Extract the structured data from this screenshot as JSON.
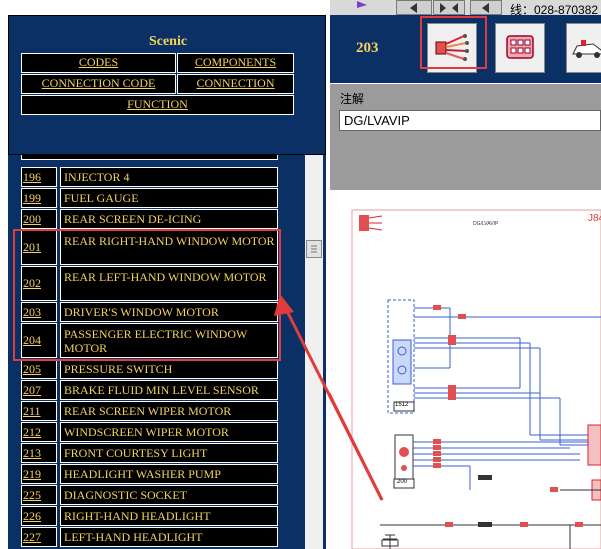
{
  "top": {
    "phone_text": "线：028-870382"
  },
  "header": {
    "vehicle": "Scenic",
    "buttons": {
      "codes": "CODES",
      "components": "COMPONENTS",
      "connection_code": "CONNECTION CODE",
      "connection": "CONNECTION",
      "function": "FUNCTION"
    },
    "part_number": "203",
    "icons": [
      "wiring-harness-icon",
      "connector-icon",
      "vehicle-icon"
    ],
    "highlight_color": "#e23b3b"
  },
  "diagram": {
    "label_chars": "注解",
    "name": "DG/LVAVIP",
    "title_small": "DG/LVAVIP",
    "corner_code": "J84",
    "labels": [
      "1512",
      "200"
    ]
  },
  "list": {
    "items": [
      {
        "num": "196",
        "label": "INJECTOR 4"
      },
      {
        "num": "199",
        "label": "FUEL GAUGE"
      },
      {
        "num": "200",
        "label": "REAR SCREEN DE-ICING"
      },
      {
        "num": "201",
        "label": "REAR RIGHT-HAND WINDOW MOTOR"
      },
      {
        "num": "202",
        "label": "REAR LEFT-HAND WINDOW MOTOR"
      },
      {
        "num": "203",
        "label": "DRIVER'S WINDOW MOTOR"
      },
      {
        "num": "204",
        "label": "PASSENGER ELECTRIC WINDOW MOTOR"
      },
      {
        "num": "205",
        "label": "PRESSURE SWITCH"
      },
      {
        "num": "207",
        "label": "BRAKE FLUID MIN LEVEL SENSOR"
      },
      {
        "num": "211",
        "label": "REAR SCREEN WIPER MOTOR"
      },
      {
        "num": "212",
        "label": "WINDSCREEN WIPER MOTOR"
      },
      {
        "num": "213",
        "label": "FRONT COURTESY LIGHT"
      },
      {
        "num": "219",
        "label": "HEADLIGHT WASHER PUMP"
      },
      {
        "num": "225",
        "label": "DIAGNOSTIC SOCKET"
      },
      {
        "num": "226",
        "label": "RIGHT-HAND HEADLIGHT"
      },
      {
        "num": "227",
        "label": "LEFT-HAND HEADLIGHT"
      }
    ]
  }
}
